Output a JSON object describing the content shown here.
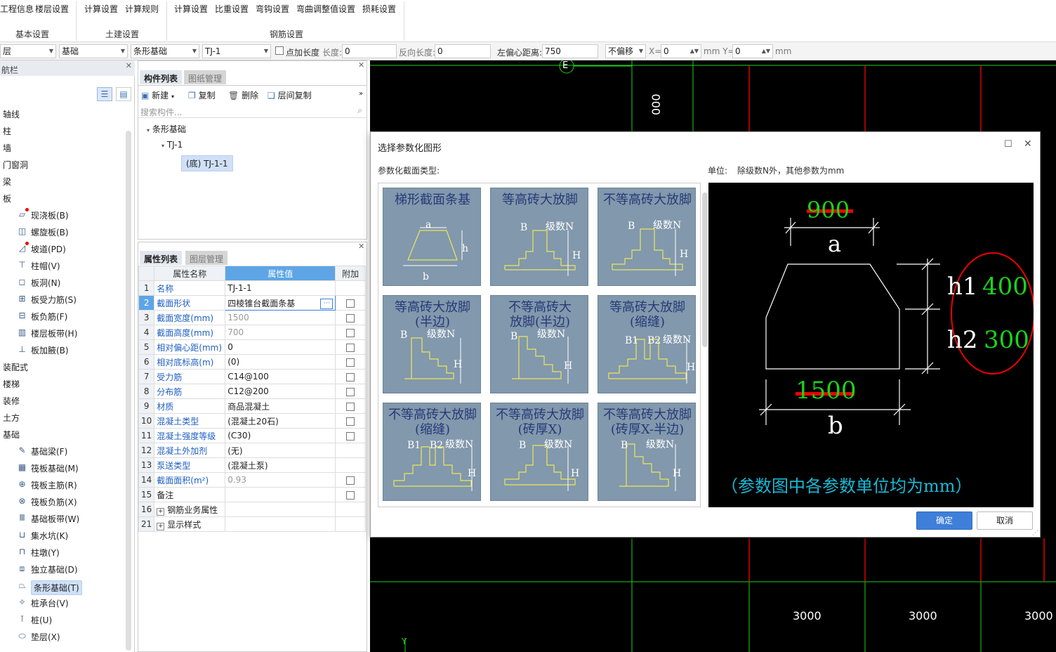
{
  "ribbon": {
    "items": [
      "工程信息",
      "楼层设置",
      "计算设置",
      "计算规则",
      "计算设置",
      "比重设置",
      "弯钩设置",
      "弯曲调整值设置",
      "损耗设置"
    ],
    "groups": [
      "基本设置",
      "土建设置",
      "钢筋设置"
    ]
  },
  "toolbar": {
    "floor": "层",
    "category": "基础",
    "type": "条形基础",
    "component": "TJ-1",
    "add_length_label": "点加长度",
    "length_label": "长度:",
    "length_value": "0",
    "reverse_label": "反向长度:",
    "reverse_value": "0",
    "offset_label": "左偏心距离:",
    "offset_value": "750",
    "shift_mode": "不偏移",
    "x_label": "X=",
    "x_value": "0",
    "y_label": "mm Y=",
    "y_value": "0",
    "unit": "mm"
  },
  "nav": {
    "title": "航栏",
    "items": [
      {
        "label": "轴线",
        "icon": "",
        "indent": false,
        "dot": false
      },
      {
        "label": "柱",
        "icon": "",
        "indent": false,
        "dot": false
      },
      {
        "label": "墙",
        "icon": "",
        "indent": false,
        "dot": false
      },
      {
        "label": "门窗洞",
        "icon": "",
        "indent": false,
        "dot": false
      },
      {
        "label": "梁",
        "icon": "",
        "indent": false,
        "dot": false
      },
      {
        "label": "板",
        "icon": "",
        "indent": false,
        "dot": false
      },
      {
        "label": "现浇板(B)",
        "icon": "slab-icon",
        "indent": true,
        "dot": true
      },
      {
        "label": "螺旋板(B)",
        "icon": "spiral-slab-icon",
        "indent": true,
        "dot": false
      },
      {
        "label": "坡道(PD)",
        "icon": "ramp-icon",
        "indent": true,
        "dot": true
      },
      {
        "label": "柱帽(V)",
        "icon": "column-cap-icon",
        "indent": true,
        "dot": false
      },
      {
        "label": "板洞(N)",
        "icon": "slab-hole-icon",
        "indent": true,
        "dot": false
      },
      {
        "label": "板受力筋(S)",
        "icon": "slab-rebar-icon",
        "indent": true,
        "dot": false
      },
      {
        "label": "板负筋(F)",
        "icon": "negative-rebar-icon",
        "indent": true,
        "dot": false
      },
      {
        "label": "楼层板带(H)",
        "icon": "slab-strip-icon",
        "indent": true,
        "dot": false
      },
      {
        "label": "板加腋(B)",
        "icon": "haunch-icon",
        "indent": true,
        "dot": false
      },
      {
        "label": "装配式",
        "icon": "",
        "indent": false,
        "dot": false
      },
      {
        "label": "楼梯",
        "icon": "",
        "indent": false,
        "dot": false
      },
      {
        "label": "装修",
        "icon": "",
        "indent": false,
        "dot": false
      },
      {
        "label": "土方",
        "icon": "",
        "indent": false,
        "dot": false
      },
      {
        "label": "基础",
        "icon": "",
        "indent": false,
        "dot": false
      },
      {
        "label": "基础梁(F)",
        "icon": "foundation-beam-icon",
        "indent": true,
        "dot": false
      },
      {
        "label": "筏板基础(M)",
        "icon": "raft-icon",
        "indent": true,
        "dot": false
      },
      {
        "label": "筏板主筋(R)",
        "icon": "raft-main-rebar-icon",
        "indent": true,
        "dot": false
      },
      {
        "label": "筏板负筋(X)",
        "icon": "raft-negative-rebar-icon",
        "indent": true,
        "dot": false
      },
      {
        "label": "基础板带(W)",
        "icon": "foundation-strip-icon",
        "indent": true,
        "dot": false
      },
      {
        "label": "集水坑(K)",
        "icon": "sump-icon",
        "indent": true,
        "dot": false
      },
      {
        "label": "柱墩(Y)",
        "icon": "column-pier-icon",
        "indent": true,
        "dot": false
      },
      {
        "label": "独立基础(D)",
        "icon": "isolated-footing-icon",
        "indent": true,
        "dot": false
      },
      {
        "label": "条形基础(T)",
        "icon": "strip-footing-icon",
        "indent": true,
        "dot": false,
        "selected": true
      },
      {
        "label": "桩承台(V)",
        "icon": "pile-cap-icon",
        "indent": true,
        "dot": false
      },
      {
        "label": "桩(U)",
        "icon": "pile-icon",
        "indent": true,
        "dot": false
      },
      {
        "label": "垫层(X)",
        "icon": "cushion-icon",
        "indent": true,
        "dot": false
      }
    ]
  },
  "component_panel": {
    "tabs": [
      "构件列表",
      "图纸管理"
    ],
    "tools": [
      "新建",
      "复制",
      "删除",
      "层间复制"
    ],
    "search_placeholder": "搜索构件...",
    "tree": [
      "条形基础",
      "TJ-1",
      "(底) TJ-1-1"
    ]
  },
  "property_panel": {
    "tabs": [
      "属性列表",
      "图层管理"
    ],
    "headers": [
      "属性名称",
      "属性值",
      "附加"
    ],
    "rows": [
      {
        "n": "1",
        "name": "名称",
        "value": "TJ-1-1",
        "check": false,
        "blue": true
      },
      {
        "n": "2",
        "name": "截面形状",
        "value": "四棱锥台截面条基",
        "check": true,
        "blue": true,
        "selected": true
      },
      {
        "n": "3",
        "name": "截面宽度(mm)",
        "value": "1500",
        "check": true,
        "blue": true,
        "gray": true
      },
      {
        "n": "4",
        "name": "截面高度(mm)",
        "value": "700",
        "check": true,
        "blue": true,
        "gray": true
      },
      {
        "n": "5",
        "name": "相对偏心距(mm)",
        "value": "0",
        "check": true,
        "blue": true
      },
      {
        "n": "6",
        "name": "相对底标高(m)",
        "value": "(0)",
        "check": true,
        "blue": true
      },
      {
        "n": "7",
        "name": "受力筋",
        "value": "C14@100",
        "check": true,
        "blue": true
      },
      {
        "n": "8",
        "name": "分布筋",
        "value": "C12@200",
        "check": true,
        "blue": true
      },
      {
        "n": "9",
        "name": "材质",
        "value": "商品混凝土",
        "check": true,
        "blue": true
      },
      {
        "n": "10",
        "name": "混凝土类型",
        "value": "(混凝土20石)",
        "check": true,
        "blue": true
      },
      {
        "n": "11",
        "name": "混凝土强度等级",
        "value": "(C30)",
        "check": true,
        "blue": true
      },
      {
        "n": "12",
        "name": "混凝土外加剂",
        "value": "(无)",
        "check": false,
        "blue": true
      },
      {
        "n": "13",
        "name": "泵送类型",
        "value": "(混凝土泵)",
        "check": false,
        "blue": true
      },
      {
        "n": "14",
        "name": "截面面积(m²)",
        "value": "0.93",
        "check": true,
        "blue": true,
        "gray": true
      },
      {
        "n": "15",
        "name": "备注",
        "value": "",
        "check": true,
        "blue": false
      },
      {
        "n": "16",
        "name": "钢筋业务属性",
        "value": "",
        "check": false,
        "blue": false,
        "expand": true
      },
      {
        "n": "21",
        "name": "显示样式",
        "value": "",
        "check": false,
        "blue": false,
        "expand": true
      }
    ]
  },
  "cad": {
    "axis_label": "E",
    "top_dim": "000",
    "bottom_dims": [
      "3000",
      "3000",
      "3000"
    ]
  },
  "dialog": {
    "title": "选择参数化图形",
    "type_label": "参数化截面类型:",
    "unit_label": "单位:",
    "unit_text": "除级数N外，其他参数为mm",
    "tiles": [
      {
        "title": "梯形截面条基",
        "labels": [
          "a",
          "h",
          "b"
        ]
      },
      {
        "title": "等高砖大放脚",
        "labels": [
          "B",
          "级数N",
          "H"
        ]
      },
      {
        "title": "不等高砖大放脚",
        "labels": [
          "B",
          "级数N",
          "H"
        ]
      },
      {
        "title": "等高砖大放脚\n(半边)",
        "labels": [
          "B",
          "级数N",
          "H"
        ]
      },
      {
        "title": "不等高砖大\n放脚(半边)",
        "labels": [
          "B",
          "级数N",
          "H"
        ]
      },
      {
        "title": "等高砖大放脚\n(缩缝)",
        "labels": [
          "B1",
          "B2",
          "级数N",
          "H"
        ]
      },
      {
        "title": "不等高砖大放脚\n(缩缝)",
        "labels": [
          "B1",
          "B2",
          "级数N",
          "H"
        ]
      },
      {
        "title": "不等高砖大放脚\n(砖厚X)",
        "labels": [
          "B",
          "级数N",
          "H"
        ]
      },
      {
        "title": "不等高砖大放脚\n(砖厚X-半边)",
        "labels": [
          "B",
          "级数N",
          "H"
        ]
      }
    ],
    "preview": {
      "a_value": "900",
      "a_label": "a",
      "b_value": "1500",
      "b_label": "b",
      "h1_label": "h1",
      "h1_value": "400",
      "h2_label": "h2",
      "h2_value": "300",
      "note": "（参数图中各参数单位均为mm）"
    },
    "ok": "确定",
    "cancel": "取消"
  },
  "colors": {
    "accent": "#3d7fd9",
    "cad_green": "#1ad41a",
    "cad_red": "#e00000",
    "tile_bg": "#8298ac"
  }
}
